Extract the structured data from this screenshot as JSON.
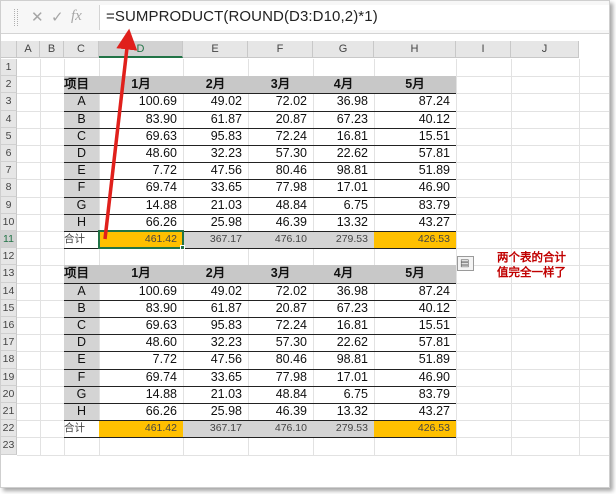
{
  "formula_bar": {
    "cancel_icon": "✕",
    "enter_icon": "✓",
    "fx_label": "fx",
    "formula": "=SUMPRODUCT(ROUND(D3:D10,2)*1)"
  },
  "columns": [
    "A",
    "B",
    "C",
    "D",
    "E",
    "F",
    "G",
    "H",
    "I",
    "J"
  ],
  "rows": [
    "1",
    "2",
    "3",
    "4",
    "5",
    "6",
    "7",
    "8",
    "9",
    "10",
    "11",
    "12",
    "13",
    "14",
    "15",
    "16",
    "17",
    "18",
    "19",
    "20",
    "21",
    "22",
    "23"
  ],
  "selected_column": "D",
  "selected_row": "11",
  "table1": {
    "headers": [
      "项目",
      "1月",
      "2月",
      "3月",
      "4月",
      "5月"
    ],
    "rows": [
      [
        "A",
        "100.69",
        "49.02",
        "72.02",
        "36.98",
        "87.24"
      ],
      [
        "B",
        "83.90",
        "61.87",
        "20.87",
        "67.23",
        "40.12"
      ],
      [
        "C",
        "69.63",
        "95.83",
        "72.24",
        "16.81",
        "15.51"
      ],
      [
        "D",
        "48.60",
        "32.23",
        "57.30",
        "22.62",
        "57.81"
      ],
      [
        "E",
        "7.72",
        "47.56",
        "80.46",
        "98.81",
        "51.89"
      ],
      [
        "F",
        "69.74",
        "33.65",
        "77.98",
        "17.01",
        "46.90"
      ],
      [
        "G",
        "14.88",
        "21.03",
        "48.84",
        "6.75",
        "83.79"
      ],
      [
        "H",
        "66.26",
        "25.98",
        "46.39",
        "13.32",
        "43.27"
      ]
    ],
    "total": [
      "合计",
      "461.42",
      "367.17",
      "476.10",
      "279.53",
      "426.53"
    ]
  },
  "table2": {
    "headers": [
      "项目",
      "1月",
      "2月",
      "3月",
      "4月",
      "5月"
    ],
    "rows": [
      [
        "A",
        "100.69",
        "49.02",
        "72.02",
        "36.98",
        "87.24"
      ],
      [
        "B",
        "83.90",
        "61.87",
        "20.87",
        "67.23",
        "40.12"
      ],
      [
        "C",
        "69.63",
        "95.83",
        "72.24",
        "16.81",
        "15.51"
      ],
      [
        "D",
        "48.60",
        "32.23",
        "57.30",
        "22.62",
        "57.81"
      ],
      [
        "E",
        "7.72",
        "47.56",
        "80.46",
        "98.81",
        "51.89"
      ],
      [
        "F",
        "69.74",
        "33.65",
        "77.98",
        "17.01",
        "46.90"
      ],
      [
        "G",
        "14.88",
        "21.03",
        "48.84",
        "6.75",
        "83.79"
      ],
      [
        "H",
        "66.26",
        "25.98",
        "46.39",
        "13.32",
        "43.27"
      ]
    ],
    "total": [
      "合计",
      "461.42",
      "367.17",
      "476.10",
      "279.53",
      "426.53"
    ]
  },
  "annotation": {
    "line1": "两个表的合计",
    "line2": "值完全一样了",
    "color": "#c00000"
  },
  "colors": {
    "accent_green": "#217346",
    "highlight_orange": "#ffc000",
    "arrow_red": "#e0201c"
  },
  "icons": {
    "quick_analysis": "quick-analysis-icon"
  }
}
